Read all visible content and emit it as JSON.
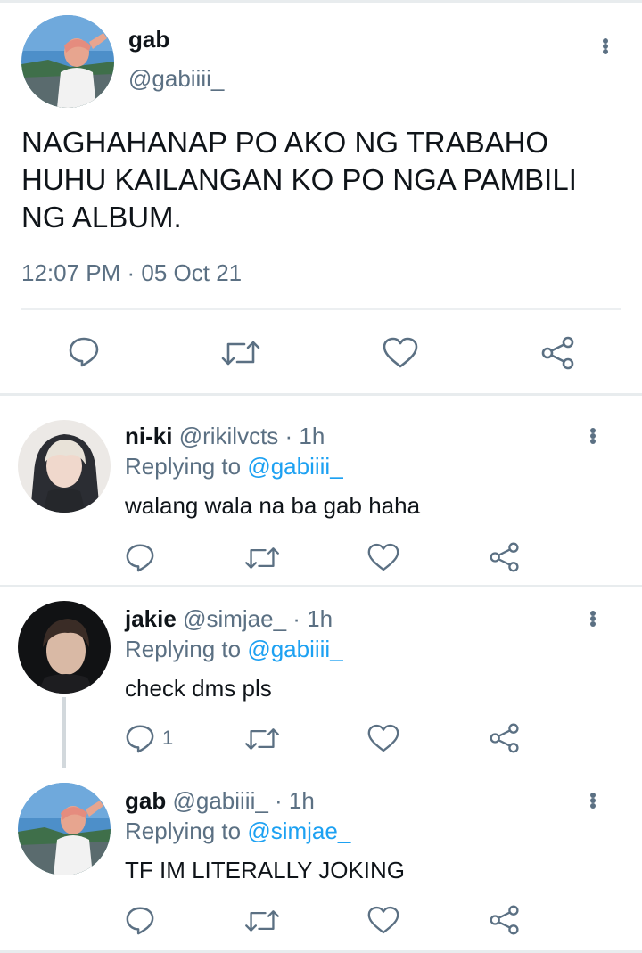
{
  "main_tweet": {
    "name": "gab",
    "handle": "@gabiiii_",
    "text_lines": [
      "NAGHAHANAP PO AKO NG TRABAHO",
      "HUHU KAILANGAN KO PO NGA PAMBILI",
      "NG ALBUM."
    ],
    "timestamp": "12:07 PM · 05 Oct 21"
  },
  "replies": [
    {
      "name": "ni-ki",
      "handle": "@rikilvcts",
      "time": "· 1h",
      "replying_prefix": "Replying to",
      "replying_to": "@gabiiii_",
      "text": "walang wala na ba gab haha",
      "reply_count": ""
    },
    {
      "name": "jakie",
      "handle": "@simjae_",
      "time": "· 1h",
      "replying_prefix": "Replying to",
      "replying_to": "@gabiiii_",
      "text": "check dms pls",
      "reply_count": "1"
    },
    {
      "name": "gab",
      "handle": "@gabiiii_",
      "time": "· 1h",
      "replying_prefix": "Replying to",
      "replying_to": "@simjae_",
      "text": "TF IM LITERALLY JOKING",
      "reply_count": ""
    }
  ],
  "colors": {
    "text": "#0f1419",
    "secondary": "#5b7083",
    "accent": "#1da1f2",
    "divider": "#e8ecee"
  },
  "icons": [
    "reply-icon",
    "retweet-icon",
    "like-icon",
    "share-icon",
    "more-icon"
  ]
}
